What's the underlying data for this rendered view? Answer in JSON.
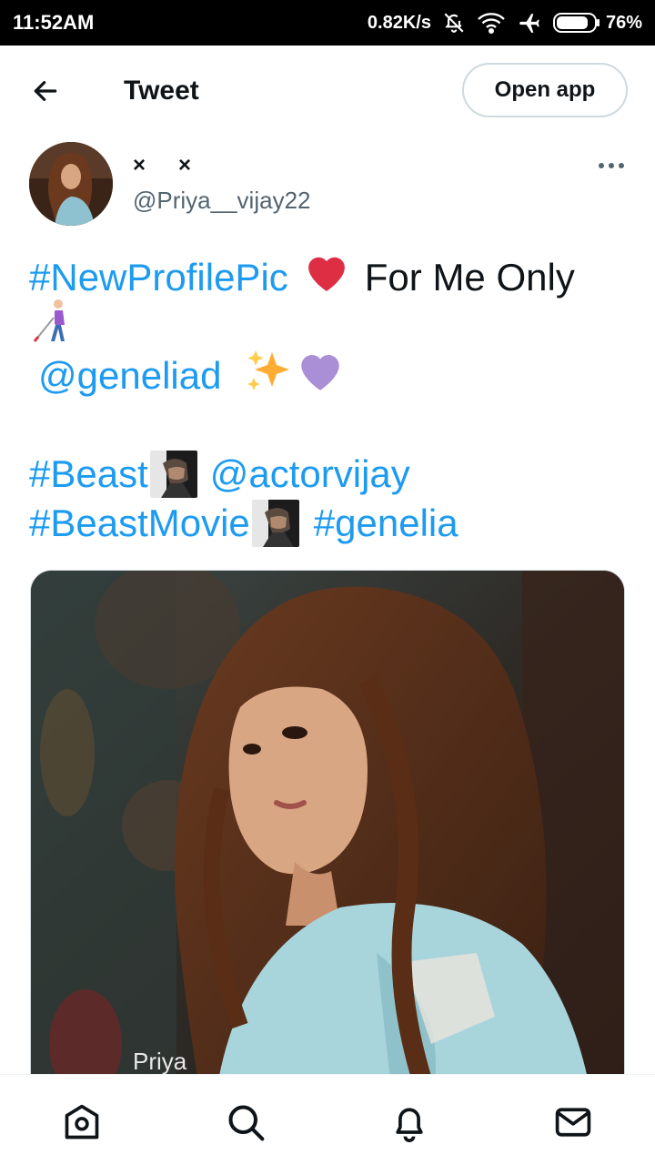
{
  "status_bar": {
    "time": "11:52AM",
    "network_speed": "0.82K/s",
    "battery": "76%",
    "icons": [
      "mute-bell-icon",
      "wifi-icon",
      "airplane-icon",
      "battery-icon"
    ]
  },
  "header": {
    "title": "Tweet",
    "open_app_label": "Open app"
  },
  "tweet": {
    "display_name": "××",
    "handle": "@Priya__vijay22",
    "line1": {
      "hashtag": "#NewProfilePic",
      "emoji_heart": "❤️",
      "text": "For Me Only"
    },
    "line2_emoji": "🧑‍🦯",
    "line3": {
      "mention": "@geneliad",
      "emoji_sparkles": "✨",
      "emoji_purple_heart": "💜"
    },
    "line4": {
      "hashtag": "#Beast",
      "mention": "@actorvijay"
    },
    "line5": {
      "hashtag": "#BeastMovie",
      "hashtag2": "#genelia"
    },
    "media_watermark": "Priya"
  },
  "colors": {
    "link": "#1d9bf0",
    "text": "#0f1419",
    "muted": "#536471"
  },
  "bottom_nav": [
    "home-icon",
    "search-icon",
    "notifications-icon",
    "messages-icon"
  ]
}
